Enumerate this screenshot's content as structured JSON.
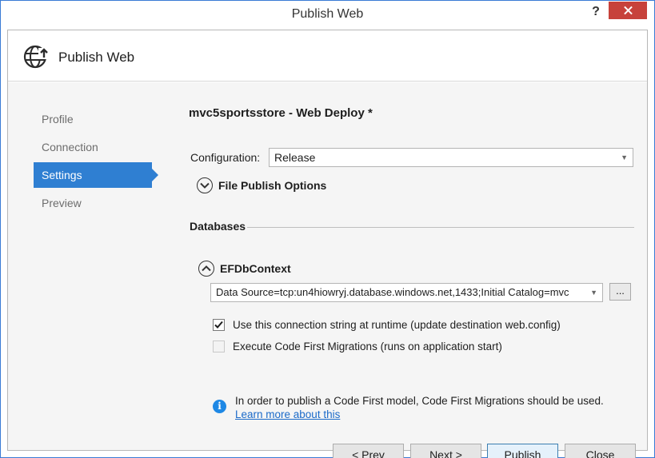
{
  "window": {
    "title": "Publish Web"
  },
  "titlebar": {
    "help_label": "?"
  },
  "header": {
    "title": "Publish Web"
  },
  "nav": {
    "items": [
      {
        "label": "Profile",
        "active": false
      },
      {
        "label": "Connection",
        "active": false
      },
      {
        "label": "Settings",
        "active": true
      },
      {
        "label": "Preview",
        "active": false
      }
    ]
  },
  "settings": {
    "profile_title": "mvc5sportsstore - Web Deploy *",
    "configuration_label": "Configuration:",
    "configuration_value": "Release",
    "file_publish_options_label": "File Publish Options",
    "databases_heading": "Databases",
    "db_context_label": "EFDbContext",
    "connection_string": "Data Source=tcp:un4hiowryj.database.windows.net,1433;Initial Catalog=mvc",
    "ellipsis_label": "...",
    "use_connection_string_label": "Use this connection string at runtime (update destination web.config)",
    "use_connection_string_checked": true,
    "execute_migrations_label": "Execute Code First Migrations (runs on application start)",
    "execute_migrations_checked": false,
    "execute_migrations_enabled": false,
    "info_text": "In order to publish a Code First model, Code First Migrations should be used.",
    "info_link": "Learn more about this"
  },
  "buttons": {
    "prev": "< Prev",
    "next": "Next >",
    "publish": "Publish",
    "close": "Close"
  },
  "colors": {
    "accent": "#2f7fd2",
    "close_red": "#c7423b",
    "link": "#1b6ac9"
  },
  "icons": {
    "header": "globe-publish-icon",
    "info": "info-icon",
    "expand": "chevron-down-icon",
    "collapse": "chevron-up-icon",
    "dropdown": "dropdown-arrow-icon"
  }
}
